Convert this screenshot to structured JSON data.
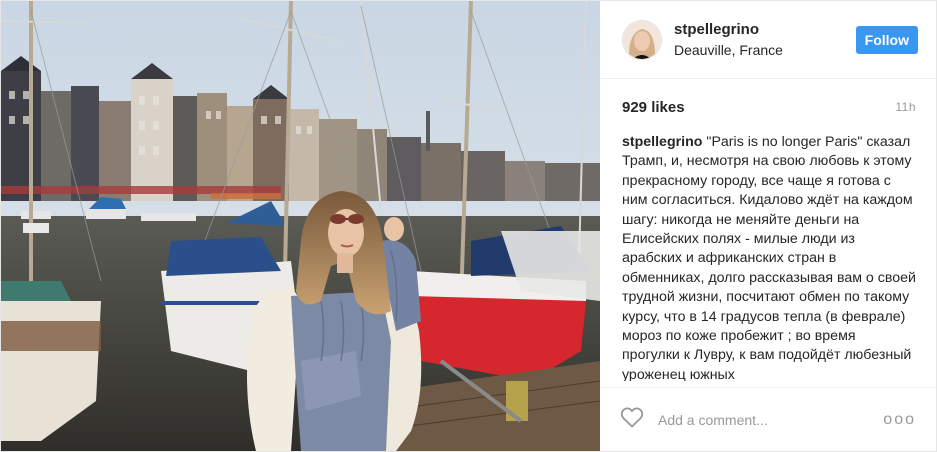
{
  "post": {
    "username": "stpellegrino",
    "location": "Deauville, France",
    "follow_label": "Follow",
    "likes": "929 likes",
    "time": "11h",
    "caption_user": "stpellegrino",
    "caption_text": "\"Paris is no longer Paris\" сказал Трамп, и, несмотря на свою любовь к этому прекрасному городу, все чаще я готова с ним согласиться. Кидалово ждёт на каждом шагу: никогда не меняйте деньги на Елисейских полях - милые люди из арабских и африканских стран в обменниках, долго рассказывая вам о своей трудной жизни, посчитают обмен по такому курсу, что в 14 градусов тепла (в феврале) мороз по коже пробежит ; во время прогулки к Лувру, к вам подойдёт любезный уроженец южных",
    "comment_placeholder": "Add a comment...",
    "more_glyph": "ooo"
  },
  "icons": {
    "avatar": "avatar-photo",
    "like": "heart-outline-icon",
    "more": "more-options-icon"
  },
  "colors": {
    "follow_button": "#3897f0",
    "text": "#262626",
    "muted": "#999999",
    "divider": "#efefef"
  }
}
